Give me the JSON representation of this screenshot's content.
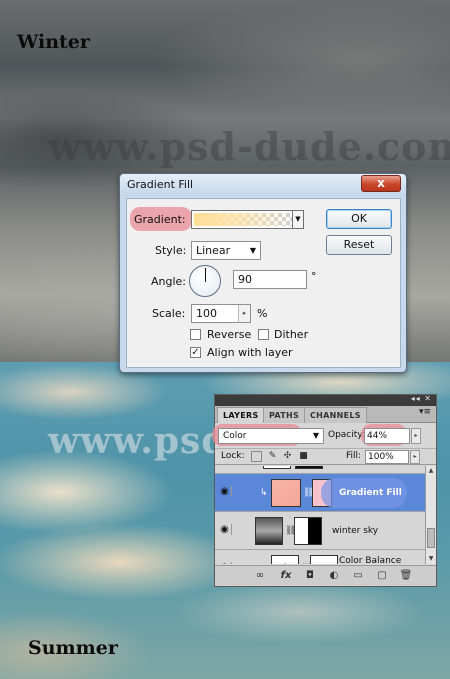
{
  "labels": {
    "winter": "Winter",
    "summer": "Summer",
    "watermark_top": "www.psd-dude.com",
    "watermark_mid": "www.psd-"
  },
  "dialog": {
    "title": "Gradient Fill",
    "close": "x",
    "gradient_label": "Gradient:",
    "style_label": "Style:",
    "style_value": "Linear",
    "angle_label": "Angle:",
    "angle_value": "90",
    "degree_sign": "°",
    "scale_label": "Scale:",
    "scale_value": "100",
    "percent": "%",
    "reverse_label": "Reverse",
    "reverse_checked": false,
    "dither_label": "Dither",
    "dither_checked": false,
    "align_label": "Align with layer",
    "align_checked": true,
    "ok_label": "OK",
    "reset_label": "Reset"
  },
  "layers_panel": {
    "tabs": [
      "LAYERS",
      "PATHS",
      "CHANNELS"
    ],
    "active_tab": "LAYERS",
    "blend_mode": "Color",
    "opacity_label": "Opacity:",
    "opacity_value": "44%",
    "lock_label": "Lock:",
    "fill_label": "Fill:",
    "fill_value": "100%",
    "layers": [
      {
        "name": "Gradient Fill",
        "selected": true,
        "visible": true
      },
      {
        "name": "winter sky",
        "selected": false,
        "visible": true
      },
      {
        "name": "Color Balance",
        "selected": false,
        "visible": true
      }
    ],
    "bottom_icons": [
      "link-icon",
      "fx-icon",
      "mask-icon",
      "adjustment-icon",
      "group-icon",
      "new-layer-icon",
      "trash-icon"
    ]
  },
  "colors": {
    "highlight_pink": "#e88c96",
    "highlight_blue": "#7896e6",
    "selected_layer": "#5a87d8",
    "close_red": "#c9452b"
  }
}
